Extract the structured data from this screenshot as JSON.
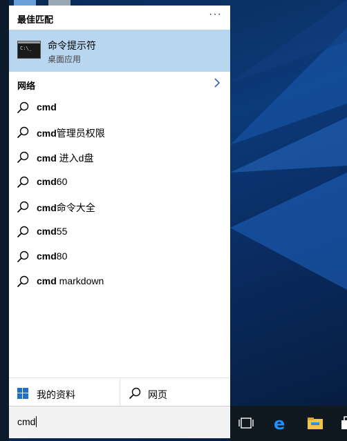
{
  "best_match": {
    "header": "最佳匹配",
    "more": "···",
    "app_title": "命令提示符",
    "app_subtitle": "桌面应用",
    "app_icon_prompt": "C:\\_"
  },
  "web": {
    "header": "网络",
    "suggestions": [
      {
        "bold": "cmd",
        "rest": ""
      },
      {
        "bold": "cmd",
        "rest": "管理员权限"
      },
      {
        "bold": "cmd",
        "rest": " 进入d盘"
      },
      {
        "bold": "cmd",
        "rest": "60"
      },
      {
        "bold": "cmd",
        "rest": "命令大全"
      },
      {
        "bold": "cmd",
        "rest": "55"
      },
      {
        "bold": "cmd",
        "rest": "80"
      },
      {
        "bold": "cmd",
        "rest": " markdown"
      }
    ]
  },
  "bottom": {
    "my_stuff": "我的资料",
    "web": "网页"
  },
  "search": {
    "value": "cmd"
  },
  "colors": {
    "highlight": "#b9d6f1",
    "accent": "#2a62b5"
  }
}
